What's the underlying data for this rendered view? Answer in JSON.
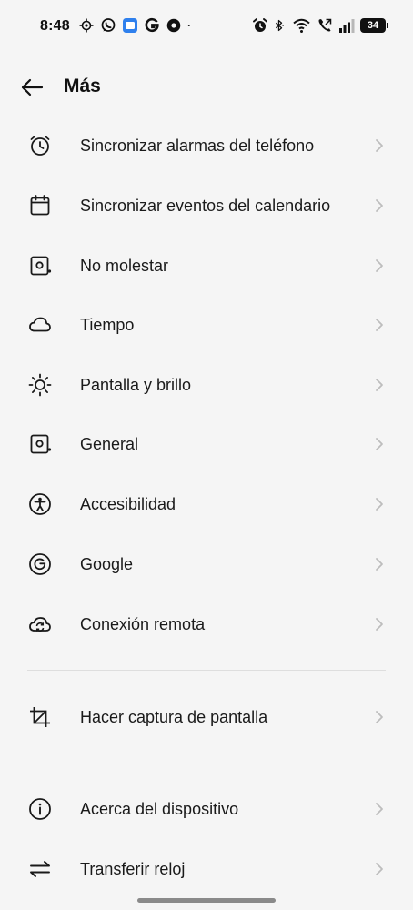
{
  "status_bar": {
    "time": "8:48",
    "left_icons": [
      "location-icon",
      "whatsapp-icon",
      "app-icon",
      "google-icon",
      "circle-app-icon",
      "dot-icon"
    ],
    "right_icons": [
      "alarm-icon",
      "bluetooth-icon",
      "wifi-icon",
      "call-icon",
      "signal-icon"
    ],
    "battery": "34"
  },
  "header": {
    "title": "Más"
  },
  "menu": {
    "items": [
      {
        "label": "Sincronizar alarmas del teléfono",
        "icon": "alarm-clock-icon"
      },
      {
        "label": "Sincronizar eventos del calendario",
        "icon": "calendar-icon"
      },
      {
        "label": "No molestar",
        "icon": "do-not-disturb-icon"
      },
      {
        "label": "Tiempo",
        "icon": "cloud-icon"
      },
      {
        "label": "Pantalla y brillo",
        "icon": "brightness-icon"
      },
      {
        "label": "General",
        "icon": "settings-square-icon"
      },
      {
        "label": "Accesibilidad",
        "icon": "accessibility-icon"
      },
      {
        "label": "Google",
        "icon": "google-icon"
      },
      {
        "label": "Conexión remota",
        "icon": "cloud-sync-icon"
      },
      {
        "label": "Hacer captura de pantalla",
        "icon": "crop-icon"
      },
      {
        "label": "Acerca del dispositivo",
        "icon": "info-icon"
      },
      {
        "label": "Transferir reloj",
        "icon": "transfer-icon"
      }
    ]
  },
  "colors": {
    "background": "#f5f5f5",
    "text": "#1a1a1a",
    "chevron": "#bdbdbd",
    "divider": "#dedede"
  }
}
